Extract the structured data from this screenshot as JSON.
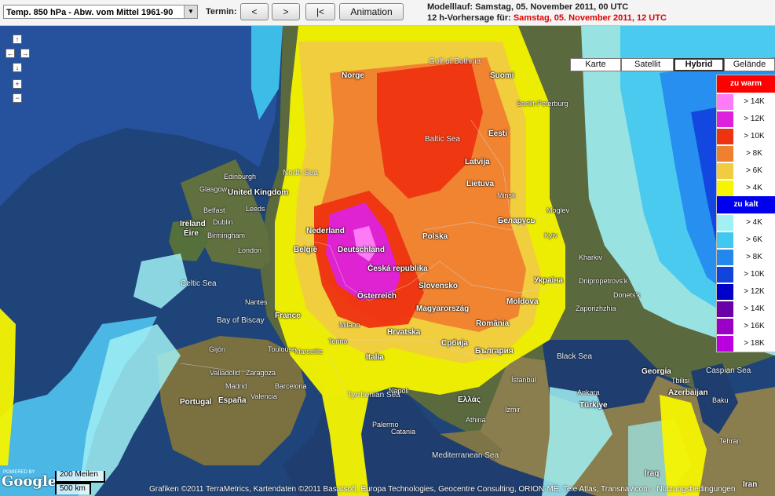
{
  "toolbar": {
    "product_select": "Temp. 850 hPa - Abw. vom Mittel 1961-90",
    "termin_label": "Termin:",
    "prev_label": "<",
    "next_label": ">",
    "first_label": "|<",
    "animation_label": "Animation",
    "modelllauf_label": "Modelllauf: Samstag, 05. November 2011, 00 UTC",
    "vorhersage_label": "12 h-Vorhersage für:",
    "vorhersage_value": "Samstag, 05. November 2011, 12 UTC"
  },
  "map_types": [
    "Karte",
    "Satellit",
    "Hybrid",
    "Gelände"
  ],
  "map_type_active": "Hybrid",
  "nav_icons": [
    "pan-up-icon",
    "pan-left-icon",
    "pan-right-icon",
    "pan-down-icon",
    "zoom-in-icon",
    "zoom-out-icon"
  ],
  "legend": {
    "warm_header": "zu warm",
    "warm_color": "#ff0000",
    "warm": [
      {
        "label": "> 14K",
        "color": "#ff7bf6"
      },
      {
        "label": "> 12K",
        "color": "#dd22dd"
      },
      {
        "label": "> 10K",
        "color": "#ee3311"
      },
      {
        "label": "> 8K",
        "color": "#f08030"
      },
      {
        "label": "> 6K",
        "color": "#f0cc40"
      },
      {
        "label": "> 4K",
        "color": "#f6f400"
      }
    ],
    "cold_header": "zu kalt",
    "cold_color": "#0000ee",
    "cold": [
      {
        "label": "> 4K",
        "color": "#a0f0f4"
      },
      {
        "label": "> 6K",
        "color": "#40c8f0"
      },
      {
        "label": "> 8K",
        "color": "#2288ee"
      },
      {
        "label": "> 10K",
        "color": "#1144dd"
      },
      {
        "label": "> 12K",
        "color": "#0000c8"
      },
      {
        "label": "> 14K",
        "color": "#6a00a8"
      },
      {
        "label": "> 16K",
        "color": "#9a00c8"
      },
      {
        "label": "> 18K",
        "color": "#bb00e0"
      }
    ]
  },
  "labels": {
    "countries": [
      {
        "text": "United Kingdom"
      },
      {
        "text": "Ireland"
      },
      {
        "text": "Éire"
      },
      {
        "text": "Norge"
      },
      {
        "text": "Suomi"
      },
      {
        "text": "Eesti"
      },
      {
        "text": "Latvija"
      },
      {
        "text": "Lietuva"
      },
      {
        "text": "Polska"
      },
      {
        "text": "Deutschland"
      },
      {
        "text": "Nederland"
      },
      {
        "text": "België"
      },
      {
        "text": "France"
      },
      {
        "text": "Česká republika"
      },
      {
        "text": "Slovensko"
      },
      {
        "text": "Österreich"
      },
      {
        "text": "Magyarország"
      },
      {
        "text": "România"
      },
      {
        "text": "Moldova"
      },
      {
        "text": "Україна"
      },
      {
        "text": "Беларусь"
      },
      {
        "text": "Hrvatska"
      },
      {
        "text": "Србија"
      },
      {
        "text": "България"
      },
      {
        "text": "Italia"
      },
      {
        "text": "España"
      },
      {
        "text": "Portugal"
      },
      {
        "text": "Ελλάς"
      },
      {
        "text": "Türkiye"
      },
      {
        "text": "Georgia"
      },
      {
        "text": "Azerbaijan"
      },
      {
        "text": "Iraq"
      },
      {
        "text": "Iran"
      }
    ],
    "seas": [
      {
        "text": "North Sea"
      },
      {
        "text": "Baltic Sea"
      },
      {
        "text": "Celtic Sea"
      },
      {
        "text": "Bay of Biscay"
      },
      {
        "text": "Tyrrhenian Sea"
      },
      {
        "text": "Black Sea"
      },
      {
        "text": "Mediterranean Sea"
      },
      {
        "text": "Caspian Sea"
      },
      {
        "text": "Gulf of Bothnia"
      }
    ],
    "cities": [
      {
        "text": "Edinburgh"
      },
      {
        "text": "Glasgow"
      },
      {
        "text": "Belfast"
      },
      {
        "text": "Leeds"
      },
      {
        "text": "Dublin"
      },
      {
        "text": "Birmingham"
      },
      {
        "text": "London"
      },
      {
        "text": "Nantes"
      },
      {
        "text": "Toulouse"
      },
      {
        "text": "Gijón"
      },
      {
        "text": "Valladolid"
      },
      {
        "text": "Zaragoza"
      },
      {
        "text": "Madrid"
      },
      {
        "text": "Barcelona"
      },
      {
        "text": "Valencia"
      },
      {
        "text": "Milano"
      },
      {
        "text": "Torino"
      },
      {
        "text": "Marseille"
      },
      {
        "text": "Napoli"
      },
      {
        "text": "Palermo"
      },
      {
        "text": "Catania"
      },
      {
        "text": "İstanbul"
      },
      {
        "text": "Ankara"
      },
      {
        "text": "Kyiv"
      },
      {
        "text": "Kharkiv"
      },
      {
        "text": "Minsk"
      },
      {
        "text": "Moglev"
      },
      {
        "text": "Sankt-Peterburg"
      },
      {
        "text": "Athina"
      },
      {
        "text": "Izmir"
      },
      {
        "text": "Tbilisi"
      },
      {
        "text": "Baku"
      },
      {
        "text": "Tehran"
      },
      {
        "text": "Zaporizhzhia"
      },
      {
        "text": "Dnipropetrovs'k"
      },
      {
        "text": "Donets'k"
      }
    ]
  },
  "scale": {
    "miles": "200 Meilen",
    "km": "500 km"
  },
  "powered_by": "POWERED BY",
  "google_logo": "Google",
  "attribution": "Grafiken ©2011 TerraMetrics, Kartendaten ©2011 Basarsoft, Europa Technologies, Geocentre Consulting, ORION-ME, Tele Atlas, Transnavicom - Nutzungsbedingungen"
}
